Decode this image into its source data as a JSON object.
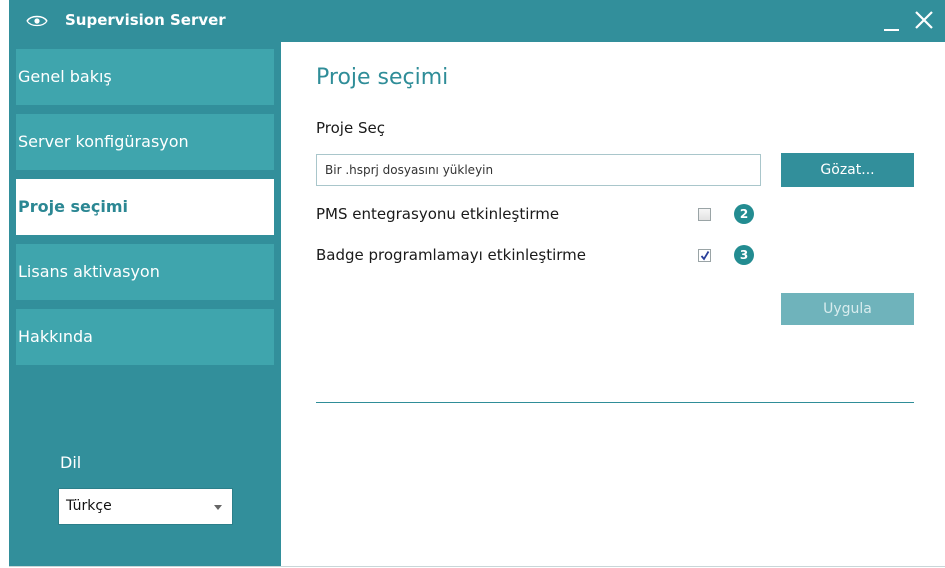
{
  "window": {
    "title": "Supervision Server",
    "icon": "eye-icon"
  },
  "sidebar": {
    "items": [
      {
        "label": "Genel bakış"
      },
      {
        "label": "Server konfigürasyon"
      },
      {
        "label": "Proje seçimi",
        "active": true
      },
      {
        "label": "Lisans aktivasyon"
      },
      {
        "label": "Hakkında"
      }
    ],
    "language": {
      "label": "Dil",
      "selected": "Türkçe"
    }
  },
  "main": {
    "title": "Proje seçimi",
    "project_label": "Proje Seç",
    "file_input": {
      "value": "Bir .hsprj dosyasını yükleyin"
    },
    "browse_label": "Gözat...",
    "options": [
      {
        "label": "PMS entegrasyonu etkinleştirme",
        "checked": false,
        "callout": "2"
      },
      {
        "label": "Badge programlamayı etkinleştirme",
        "checked": true,
        "callout": "3"
      }
    ],
    "apply_label": "Uygula"
  },
  "colors": {
    "teal_dark": "#328f9b",
    "teal_light": "#3fa5ad",
    "title_teal": "#2f8d98",
    "callout": "#238c91"
  }
}
